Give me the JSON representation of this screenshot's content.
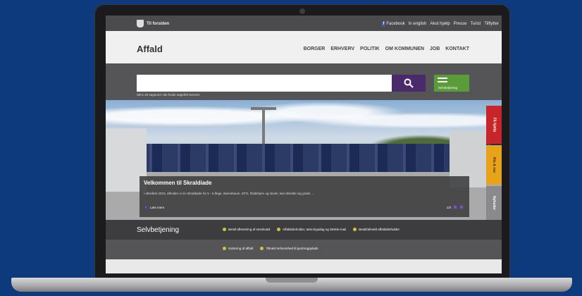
{
  "topbar": {
    "home_label": "Til forsiden",
    "links": [
      "Facebook",
      "In english",
      "Akut hjælp",
      "Presse",
      "Turist",
      "Tilflytter"
    ]
  },
  "header": {
    "title": "Affald",
    "nav": [
      "BORGER",
      "ERHVERV",
      "POLITIK",
      "OM KOMMUNEN",
      "JOB",
      "KONTAKT"
    ]
  },
  "search": {
    "value": "",
    "hint": "Skriv dit søgeord i det hvide søgefelt herover.",
    "self_service_label": "Selvbetjening"
  },
  "hero": {
    "title": "Velkommen til Skraldiade",
    "text": "I efteråret 2015, afholder vi en Skraldiade for 5 - 6 årige. Børnehaver, SFO, fritidshjem og skoler, kan tilmelde sig gratis ...",
    "read_more": "Læs mere",
    "pager": "1/3"
  },
  "side_tabs": {
    "help": "Få hjælp",
    "praise": "Ris & ros",
    "news": "Nyheder"
  },
  "selfservice": {
    "title": "Selvbetjening",
    "row1": [
      "Bestil afhentning af storskrald",
      "Affaldsbeholder, tømningsdag og SMS/e-mail",
      "Bestil/afmeld affaldsbeholder"
    ],
    "row2": [
      "Sortering af affald",
      "Tilmeld virksomhed til genbrugsplads"
    ]
  },
  "colors": {
    "background": "#0d3a7d",
    "search_button": "#4b2a6b",
    "self_service_button": "#5a9b3a",
    "help_tab": "#c8252b",
    "praise_tab": "#e7a41b",
    "news_tab": "#8a8a8c"
  }
}
